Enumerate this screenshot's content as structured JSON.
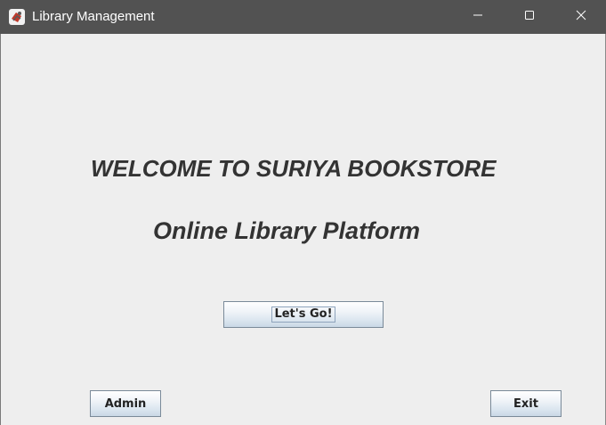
{
  "window": {
    "title": "Library Management",
    "app_icon": "java-app-icon",
    "controls": {
      "minimize_icon": "minimize-icon",
      "maximize_icon": "maximize-icon",
      "close_icon": "close-icon"
    },
    "titlebar_color": "#525252"
  },
  "main": {
    "welcome_text": "WELCOME TO SURIYA BOOKSTORE",
    "subtitle_text": "Online Library Platform",
    "lets_go_label": "Let's Go!",
    "admin_label": "Admin",
    "exit_label": "Exit",
    "background_color": "#eeeeee",
    "text_color": "#333333"
  }
}
